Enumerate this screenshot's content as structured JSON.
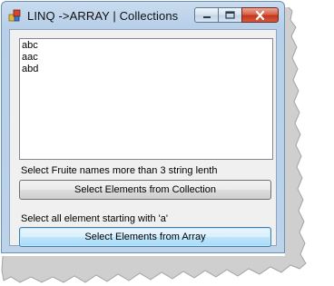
{
  "window": {
    "title": "LINQ ->ARRAY | Collections"
  },
  "caption": {
    "minimize_icon": "minimize-icon",
    "maximize_icon": "maximize-icon",
    "close_icon": "close-icon"
  },
  "listbox": {
    "items": [
      "abc",
      "aac",
      "abd"
    ]
  },
  "collection_section": {
    "label": "Select Fruite names more than 3 string lenth",
    "button_label": "Select Elements from Collection"
  },
  "array_section": {
    "label": "Select all element starting with 'a'",
    "button_label": "Select Elements from Array"
  },
  "colors": {
    "title_bar": "#c9dcef",
    "client_bg": "#f0f0f0",
    "close_button": "#c4361d",
    "focused_button_border": "#3c7fb1"
  }
}
